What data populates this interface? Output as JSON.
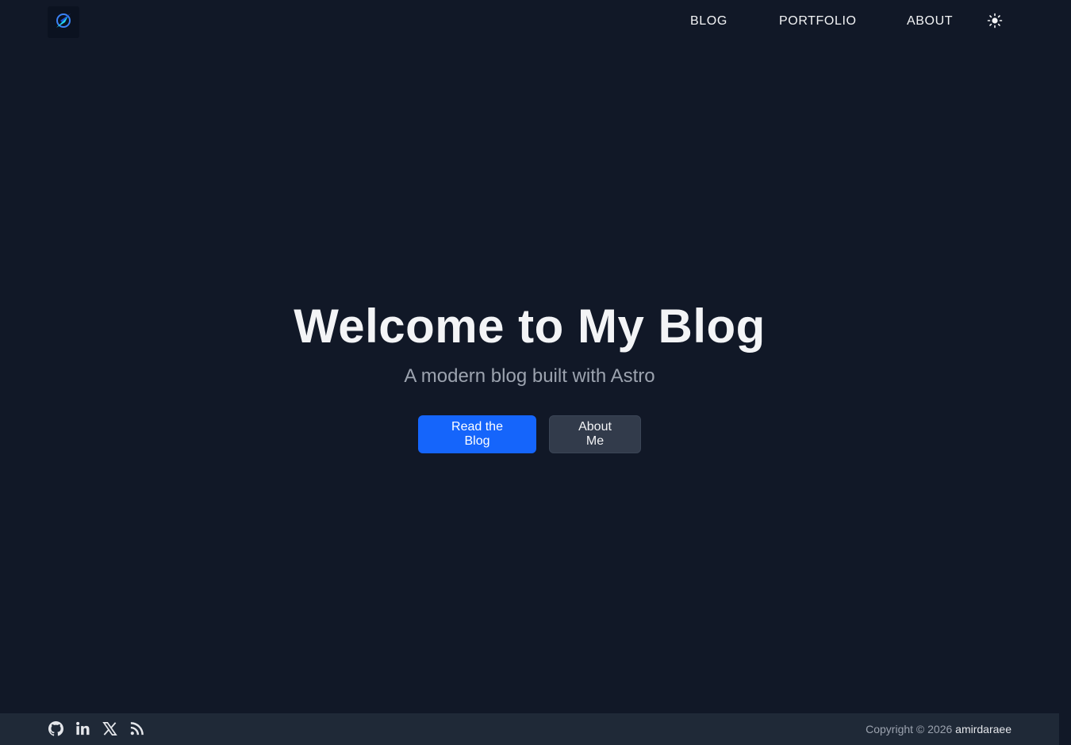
{
  "nav": {
    "logo_icon": "compass-icon",
    "items": [
      {
        "label": "BLOG"
      },
      {
        "label": "PORTFOLIO"
      },
      {
        "label": "ABOUT"
      }
    ],
    "theme_toggle_icon": "sun-icon"
  },
  "hero": {
    "title": "Welcome to My Blog",
    "subtitle": "A modern blog built with Astro",
    "primary_button": "Read the Blog",
    "secondary_button": "About Me"
  },
  "footer": {
    "social_icons": [
      "github-icon",
      "linkedin-icon",
      "x-icon",
      "rss-icon"
    ],
    "copyright_prefix": "Copyright © 2026",
    "copyright_owner": "amirdaraee"
  },
  "colors": {
    "background": "#111827",
    "footer_background": "#1f2937",
    "primary": "#1565fb",
    "secondary_button": "#323b4b",
    "logo_accent": "#22d3ee"
  }
}
